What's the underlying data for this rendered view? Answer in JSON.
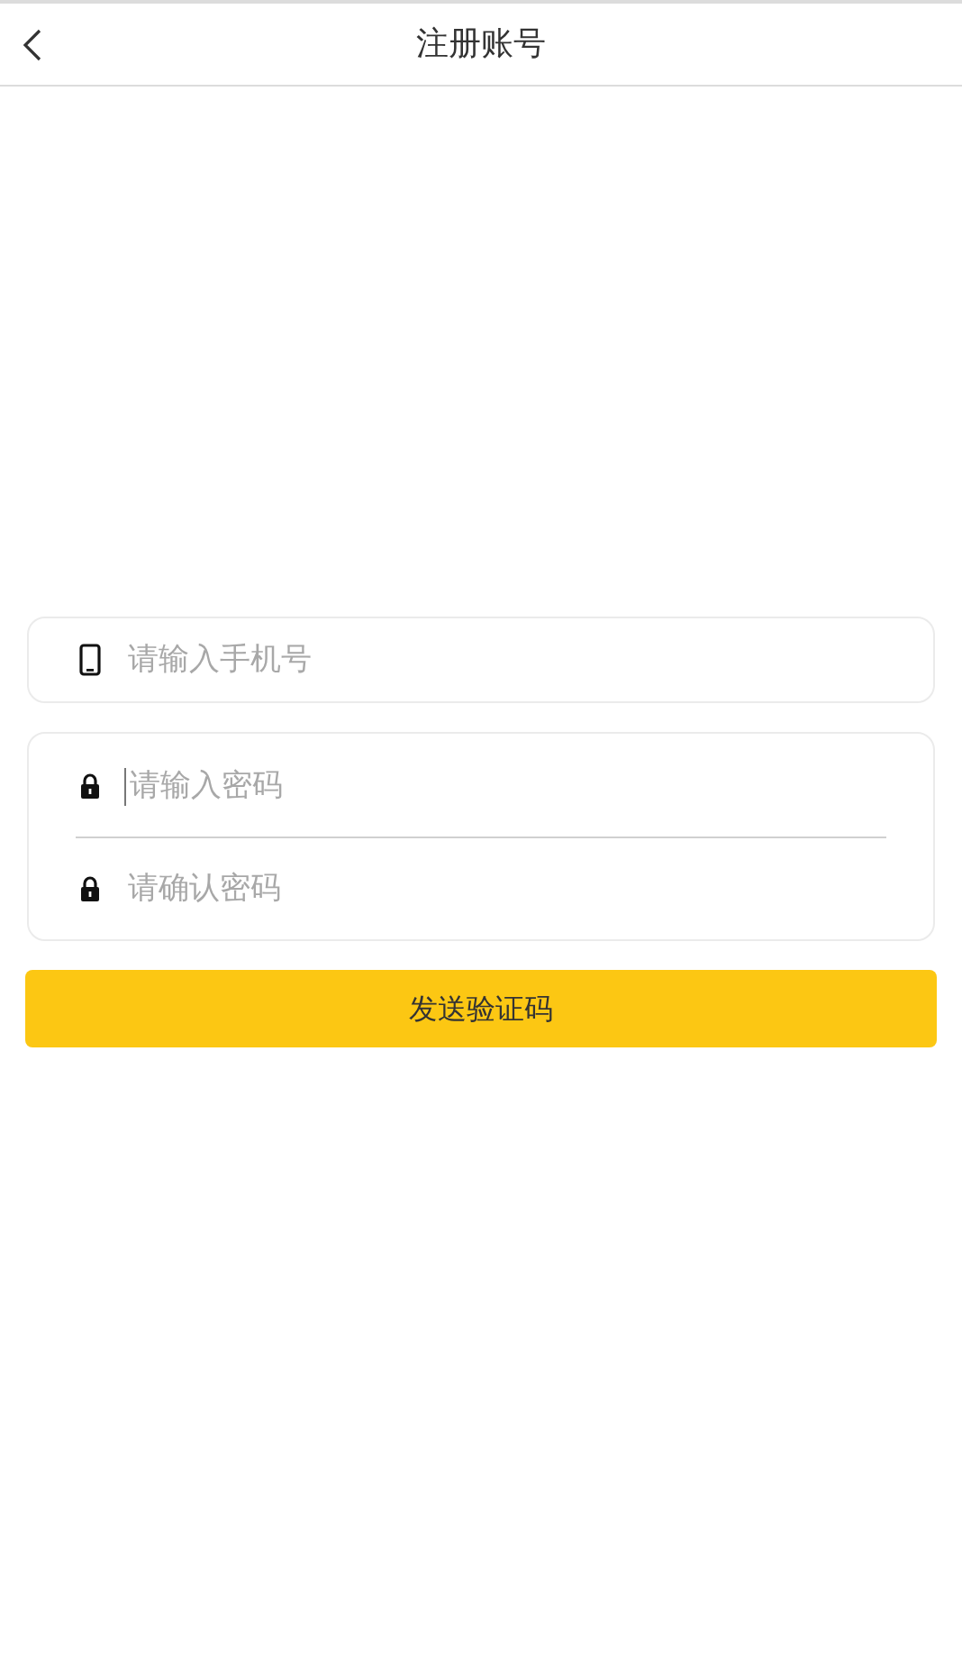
{
  "header": {
    "title": "注册账号"
  },
  "phone_group": [
    {
      "kind": "phone",
      "placeholder": "请输入手机号",
      "focused": false
    }
  ],
  "password_group": [
    {
      "kind": "password",
      "placeholder": "请输入密码",
      "focused": true
    },
    {
      "kind": "password",
      "placeholder": "请确认密码",
      "focused": false
    }
  ],
  "submit_button": "发送验证码"
}
